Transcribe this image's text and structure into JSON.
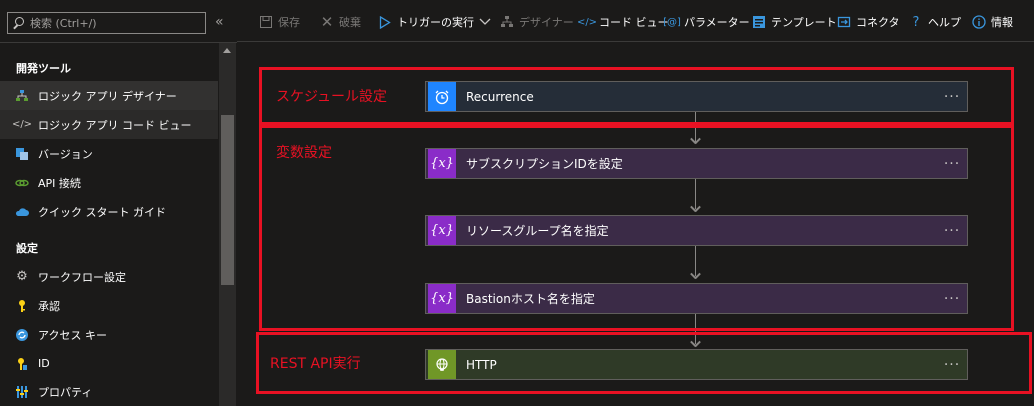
{
  "sidebar": {
    "search_placeholder": "検索 (Ctrl+/)",
    "collapse": "«",
    "sections": [
      {
        "title": "開発ツール"
      },
      {
        "title": "設定"
      }
    ],
    "items": [
      {
        "label": "ロジック アプリ デザイナー",
        "icon": "designer-icon"
      },
      {
        "label": "ロジック アプリ コード ビュー",
        "icon": "code-icon"
      },
      {
        "label": "バージョン",
        "icon": "versions-icon"
      },
      {
        "label": "API 接続",
        "icon": "link-icon"
      },
      {
        "label": "クイック スタート ガイド",
        "icon": "cloud-icon"
      },
      {
        "label": "ワークフロー設定",
        "icon": "gear-icon"
      },
      {
        "label": "承認",
        "icon": "key-icon"
      },
      {
        "label": "アクセス キー",
        "icon": "refresh-key-icon"
      },
      {
        "label": "ID",
        "icon": "identity-icon"
      },
      {
        "label": "プロパティ",
        "icon": "properties-icon"
      }
    ]
  },
  "toolbar": {
    "save": "保存",
    "discard": "破棄",
    "run_trigger": "トリガーの実行",
    "designer": "デザイナー",
    "code_view": "コード ビュー",
    "parameters": "パラメーター",
    "templates": "テンプレート",
    "connectors": "コネクタ",
    "help": "ヘルプ",
    "info": "情報"
  },
  "groups": {
    "schedule": "スケジュール設定",
    "variables": "変数設定",
    "rest": "REST API実行"
  },
  "cards": {
    "recurrence": "Recurrence",
    "var1": "サブスクリプションIDを設定",
    "var2": "リソースグループ名を指定",
    "var3": "Bastionホスト名を指定",
    "http": "HTTP",
    "menu": "···"
  },
  "colors": {
    "accent_blue": "#3a96dd",
    "highlight_red": "#e81123",
    "schedule_icon": "#1f85ff",
    "variable_icon": "#8a2cc8",
    "http_icon": "#709727"
  }
}
